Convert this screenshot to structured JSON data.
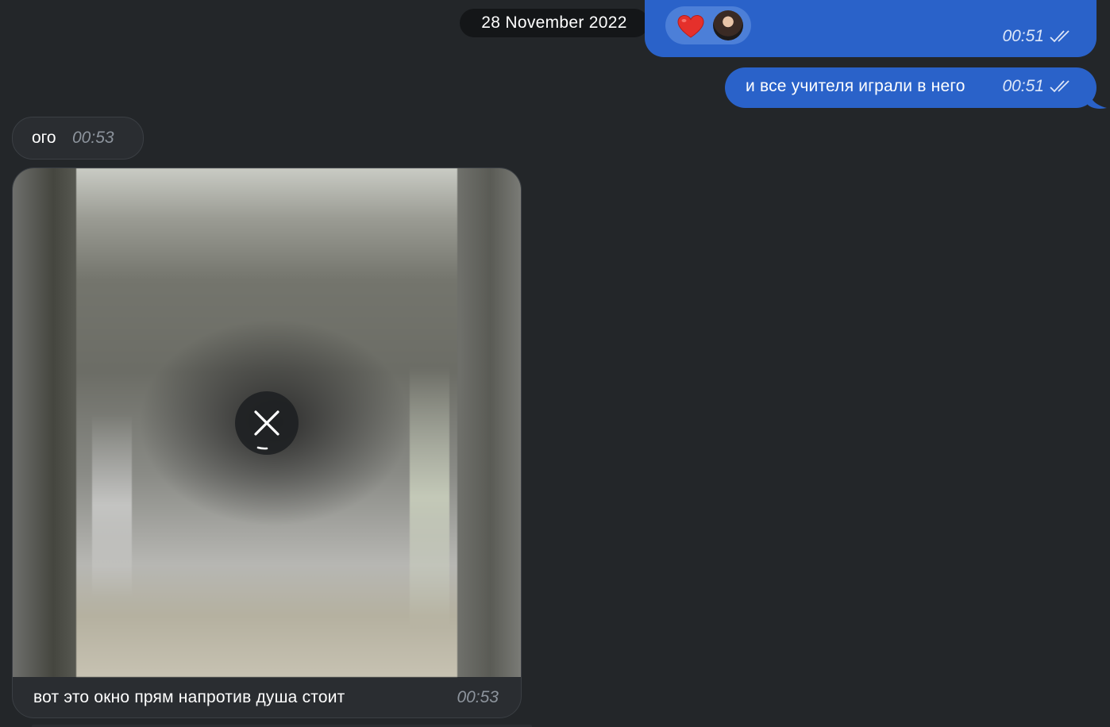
{
  "date_separator": "28 November 2022",
  "messages": [
    {
      "direction": "outgoing",
      "reaction": {
        "emoji": "❤️",
        "icon": "heart-icon",
        "color": "#e5302b"
      },
      "time": "00:51",
      "status_icon": "double-check-icon"
    },
    {
      "direction": "outgoing",
      "text": "и все учителя играли в него",
      "time": "00:51",
      "status_icon": "double-check-icon"
    },
    {
      "direction": "incoming",
      "text": "ого",
      "time": "00:53"
    },
    {
      "direction": "incoming",
      "media": {
        "type": "photo",
        "state": "loading",
        "control_icon": "close-icon"
      },
      "caption": "вот это окно прям напротив душа стоит",
      "time": "00:53"
    }
  ],
  "colors": {
    "background": "#232629",
    "outgoing_bubble": "#2a62c9",
    "incoming_bubble": "#2a2d31",
    "date_pill": "#141618"
  }
}
